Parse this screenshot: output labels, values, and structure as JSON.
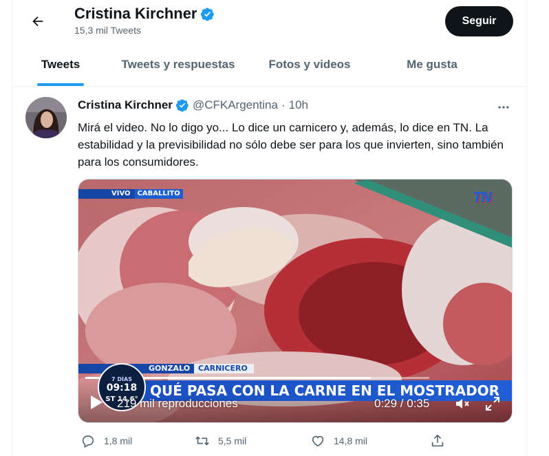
{
  "header": {
    "back_icon": "arrow-left-icon",
    "name": "Cristina Kirchner",
    "tweet_count": "15,3 mil Tweets",
    "follow_label": "Seguir"
  },
  "tabs": [
    {
      "label": "Tweets",
      "active": true
    },
    {
      "label": "Tweets y respuestas",
      "active": false
    },
    {
      "label": "Fotos y videos",
      "active": false
    },
    {
      "label": "Me gusta",
      "active": false
    }
  ],
  "tweet": {
    "author_name": "Cristina Kirchner",
    "handle": "@CFKArgentina",
    "separator": "·",
    "time": "10h",
    "more_icon": "ellipsis-icon",
    "text": "Mirá el video. No lo digo yo... Lo dice un carnicero y, además, lo dice en TN. La estabilidad y la previsibilidad no sólo debe ser para los que invierten, sino también para los consumidores.",
    "video": {
      "live_tag": "VIVO",
      "location_tag": "CABALLITO",
      "channel_logo": "TN",
      "person_name": "GONZALO",
      "person_role": "CARNICERO",
      "headline": "QUÉ PASA CON LA CARNE EN EL MOSTRADOR",
      "clock_time": "09:18",
      "clock_temp": "ST 14,6°",
      "clock_channel": "7 DÍAS",
      "views": "219 mil reproducciones",
      "time_display": "0:29 / 0:35",
      "progress_fraction": 0.83
    },
    "actions": {
      "replies": "1,8 mil",
      "retweets": "5,5 mil",
      "likes": "14,8 mil"
    }
  },
  "colors": {
    "accent": "#1d9bf0",
    "text_primary": "#0f1419",
    "text_secondary": "#536471",
    "follow_bg": "#0f1419"
  }
}
